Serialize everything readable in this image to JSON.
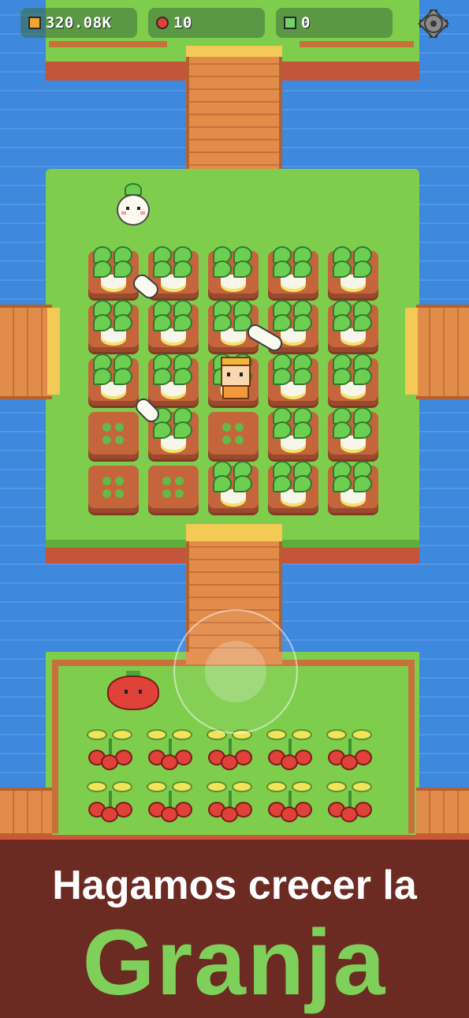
{
  "hud": {
    "coins": {
      "value": "320.08K",
      "icon": "coin-icon",
      "color": "#f2a530"
    },
    "apples": {
      "value": "10",
      "icon": "apple-icon",
      "color": "#e0423a"
    },
    "gems": {
      "value": "0",
      "icon": "gem-icon",
      "color": "#6fd36a"
    },
    "settings": {
      "icon": "gear-icon"
    }
  },
  "banner": {
    "line1": "Hagamos crecer la",
    "line2": "Granja",
    "line2_color": "#7fd05a",
    "background": "#6b2a22"
  },
  "farm": {
    "turnip_plots": [
      [
        "grown",
        "grown",
        "grown",
        "grown",
        "grown"
      ],
      [
        "grown",
        "grown",
        "grown",
        "grown",
        "grown"
      ],
      [
        "grown",
        "grown",
        "grown",
        "grown",
        "grown"
      ],
      [
        "sprout",
        "grown",
        "sprout",
        "grown",
        "grown"
      ],
      [
        "sprout",
        "sprout",
        "grown",
        "grown",
        "grown"
      ]
    ],
    "tomato_rows": 2,
    "tomato_cols": 5
  },
  "characters": [
    "turnip-npc-icon",
    "farmer-player-icon",
    "tomato-npc-icon"
  ],
  "controls": {
    "joystick": "joystick-icon"
  }
}
